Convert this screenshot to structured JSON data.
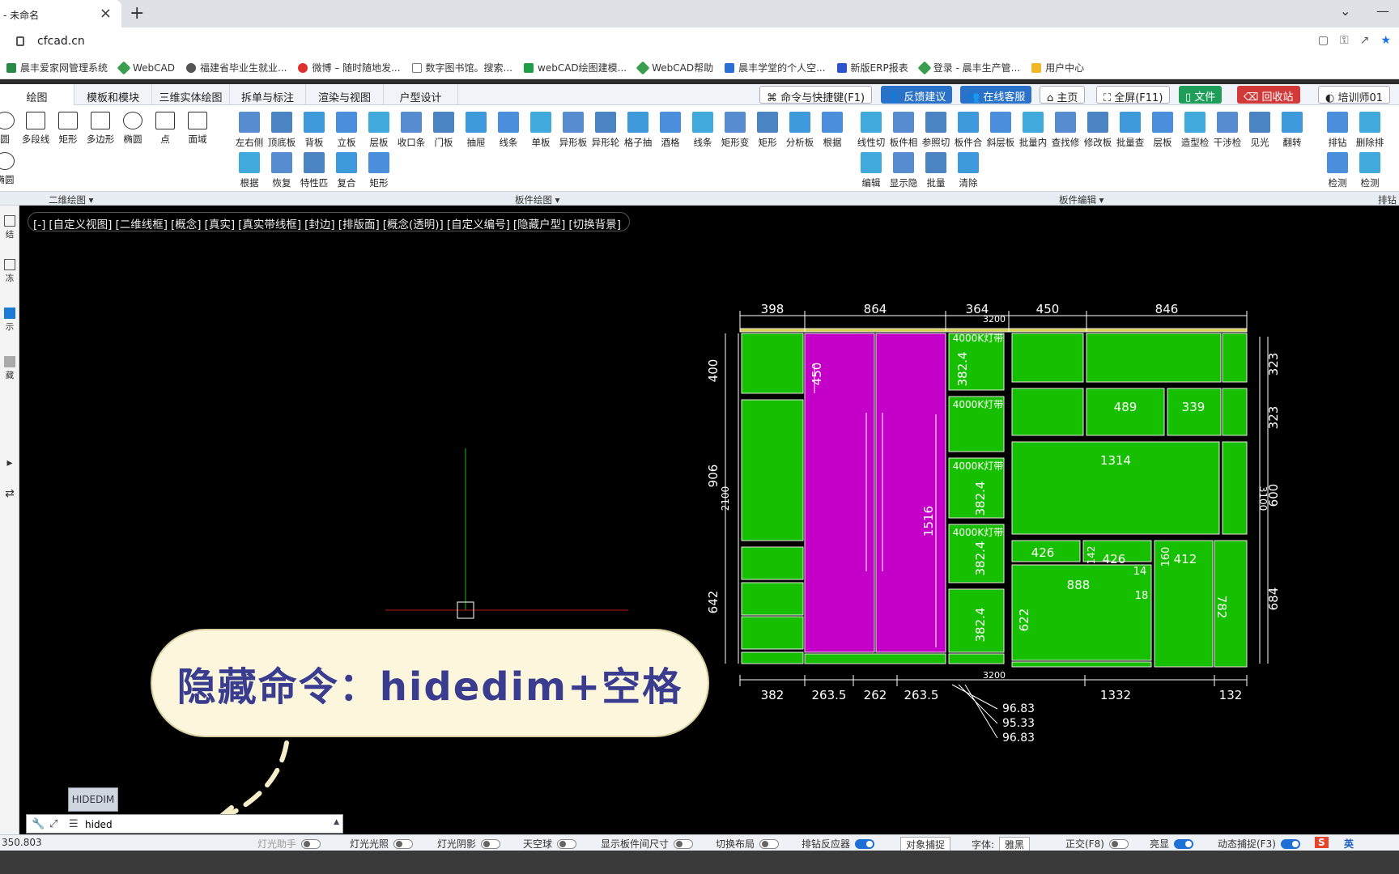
{
  "browser": {
    "tab_title": "- 未命名",
    "url": "cfcad.cn",
    "bookmarks": [
      "晨丰爱家网管理系统",
      "WebCAD",
      "福建省毕业生就业...",
      "微博 – 随时随地发...",
      "数字图书馆。搜索...",
      "webCAD绘图建模...",
      "WebCAD帮助",
      "晨丰学堂的个人空...",
      "新版ERP报表",
      "登录 - 晨丰生产管...",
      "用户中心"
    ]
  },
  "ribbon_tabs": [
    "绘图",
    "模板和模块",
    "三维实体绘图",
    "拆单与标注",
    "渲染与视图",
    "户型设计"
  ],
  "top_buttons": {
    "shortcuts": "命令与快捷键(F1)",
    "feedback": "反馈建议",
    "support": "在线客服",
    "home": "主页",
    "fullscreen": "全屏(F11)",
    "file": "文件",
    "recycle": "回收站",
    "user": "培训师01"
  },
  "tools_row1": [
    "圆",
    "多段线",
    "矩形",
    "多边形",
    "椭圆",
    "点",
    "面域",
    "左右侧",
    "顶底板",
    "背板",
    "立板",
    "层板",
    "收口条",
    "门板",
    "抽屉",
    "线条",
    "单板",
    "异形板",
    "异形轮",
    "格子抽",
    "酒格",
    "线条",
    "矩形变",
    "矩形",
    "分析板",
    "根据",
    "线性切",
    "板件相",
    "参照切",
    "板件合",
    "斜层板",
    "批量内",
    "查找修",
    "修改板",
    "批量查",
    "层板",
    "造型检",
    "干涉检",
    "见光",
    "翻转",
    "排钻",
    "删除排"
  ],
  "tools_row2": [
    "椭圆",
    "根据",
    "恢复",
    "特性匹",
    "复合",
    "矩形",
    "编辑",
    "显示隐",
    "批量",
    "清除",
    "检测",
    "检测"
  ],
  "ribbon_groups": [
    "二维绘图",
    "板件绘图",
    "板件编辑",
    "排钻"
  ],
  "left_strip": [
    "结",
    "冻",
    "示",
    "藏"
  ],
  "view_bar": [
    "[-]",
    "[自定义视图]",
    "[二维线框]",
    "[概念]",
    "[真实]",
    "[真实带线框]",
    "[封边]",
    "[排版面]",
    "[概念(透明)]",
    "[自定义编号]",
    "[隐藏户型]",
    "[切换背景]"
  ],
  "callout": "隐藏命令：hidedim+空格",
  "command": {
    "popup": "HIDEDIM",
    "input_value": "hided"
  },
  "status": {
    "coords": "350.803",
    "items": [
      {
        "label": "灯光助手",
        "on": false
      },
      {
        "label": "灯光光照",
        "on": false
      },
      {
        "label": "灯光阴影",
        "on": false
      },
      {
        "label": "天空球",
        "on": false
      },
      {
        "label": "显示板件间尺寸",
        "on": false
      },
      {
        "label": "切换布局",
        "on": false
      },
      {
        "label": "排钻反应器",
        "on": true
      }
    ],
    "snap": "对象捕捉",
    "font_label": "字体:",
    "font_value": "雅黑",
    "ortho": "正交(F8)",
    "bright": "亮显",
    "dyn_snap": "动态捕捉(F3)",
    "ime": "英"
  },
  "drawing": {
    "top_dims": [
      "398",
      "864",
      "364",
      "450",
      "846",
      "3200"
    ],
    "bottom_dims": [
      "382",
      "263.5",
      "262",
      "263.5",
      "3200",
      "1332",
      "132"
    ],
    "right_dims": [
      "323",
      "323",
      "600",
      "684",
      "3100"
    ],
    "left_dims": [
      "400",
      "906",
      "642",
      "2100"
    ],
    "sub_dims": [
      "96.83",
      "95.33",
      "96.83"
    ],
    "inner_labels": [
      "450",
      "1516",
      "382.4",
      "382.4",
      "382.4",
      "382.4",
      "489",
      "339",
      "1314",
      "426",
      "426",
      "888",
      "412",
      "622",
      "782",
      "14",
      "18",
      "160",
      "142",
      "4000K灯带",
      "4000K灯带",
      "4000K灯带",
      "4000K灯带"
    ],
    "colors": {
      "panel": "#16c000",
      "door": "#c400c8",
      "dim": "#ffffff",
      "edge": "#d8d24a"
    }
  }
}
